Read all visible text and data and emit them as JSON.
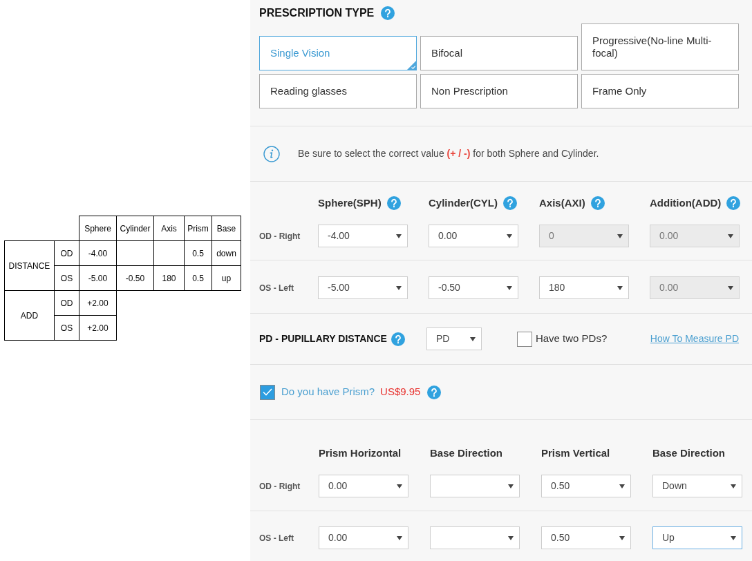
{
  "reference_table": {
    "columns": [
      "Sphere",
      "Cylinder",
      "Axis",
      "Prism",
      "Base"
    ],
    "groups": [
      {
        "label": "DISTANCE",
        "kind": "full",
        "rows": [
          {
            "eye": "OD",
            "sphere": "-4.00",
            "prism": "0.5",
            "base": "down"
          },
          {
            "eye": "OS",
            "sphere": "-5.00",
            "cylinder": "-0.50",
            "axis": "180",
            "prism": "0.5",
            "base": "up"
          }
        ]
      },
      {
        "label": "ADD",
        "kind": "sphere_only",
        "rows": [
          {
            "eye": "OD",
            "sphere": "+2.00"
          },
          {
            "eye": "OS",
            "sphere": "+2.00"
          }
        ]
      }
    ]
  },
  "prescription_type": {
    "title": "PRESCRIPTION TYPE",
    "options": [
      {
        "label": "Single Vision",
        "selected": true
      },
      {
        "label": "Bifocal",
        "selected": false
      },
      {
        "label": "Progressive(No-line Multi-focal)",
        "selected": false
      },
      {
        "label": "Reading glasses",
        "selected": false
      },
      {
        "label": "Non Prescription",
        "selected": false
      },
      {
        "label": "Frame Only",
        "selected": false
      }
    ]
  },
  "notice": {
    "text": "Be sure to select the correct value **(+ / -)** for both Sphere and Cylinder."
  },
  "prescription": {
    "columns": [
      "Sphere(SPH)",
      "Cylinder(CYL)",
      "Axis(AXI)",
      "Addition(ADD)"
    ],
    "rows": [
      {
        "label": "OD - Right",
        "fields": [
          {
            "value": "-4.00",
            "disabled": false
          },
          {
            "value": "0.00",
            "disabled": false
          },
          {
            "value": "0",
            "disabled": true
          },
          {
            "value": "0.00",
            "disabled": true
          }
        ]
      },
      {
        "label": "OS - Left",
        "fields": [
          {
            "value": "-5.00",
            "disabled": false
          },
          {
            "value": "-0.50",
            "disabled": false
          },
          {
            "value": "180",
            "disabled": false
          },
          {
            "value": "0.00",
            "disabled": true
          }
        ]
      }
    ]
  },
  "pd": {
    "title": "PD - PUPILLARY DISTANCE",
    "select": "PD",
    "two_pds": {
      "label": "Have two PDs?",
      "checked": false
    },
    "link": "How To Measure PD"
  },
  "prism_option": {
    "label": "Do you have Prism?",
    "price": "US$9.95",
    "checked": true
  },
  "prism": {
    "columns": [
      "Prism Horizontal",
      "Base Direction",
      "Prism Vertical",
      "Base Direction"
    ],
    "rows": [
      {
        "label": "OD - Right",
        "fields": [
          {
            "value": "0.00",
            "focused": false
          },
          {
            "focused": false
          },
          {
            "value": "0.50",
            "focused": false
          },
          {
            "value": "Down",
            "focused": false
          }
        ]
      },
      {
        "label": "OS - Left",
        "fields": [
          {
            "value": "0.00",
            "focused": false
          },
          {
            "focused": false
          },
          {
            "value": "0.50",
            "focused": false
          },
          {
            "value": "Up",
            "focused": true
          }
        ]
      }
    ]
  }
}
